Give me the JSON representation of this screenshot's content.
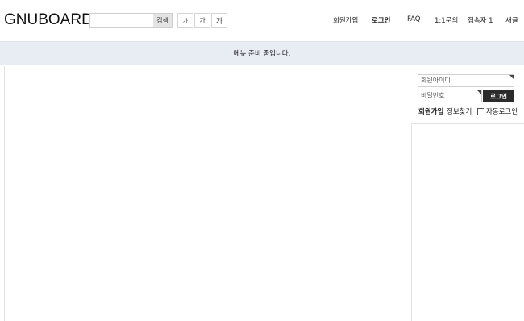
{
  "header": {
    "logo": "GNUBOARD5",
    "search": {
      "placeholder": "",
      "value": "",
      "button_label": "검색"
    },
    "font_size_buttons": [
      "가",
      "가",
      "가"
    ],
    "nav": [
      "회원가입",
      "로그인",
      "FAQ",
      "1:1문의",
      "접속자 1",
      "새글"
    ]
  },
  "notice": {
    "text": "메뉴 준비 중입니다."
  },
  "login": {
    "id_placeholder": "회원아이디",
    "pw_placeholder": "비밀번호",
    "button_label": "로그인",
    "register_label": "회원가입",
    "find_label": "정보찾기",
    "auto_login_label": "자동로그인",
    "auto_login_checked": false
  },
  "colors": {
    "notice_bg": "#e8ecf3",
    "login_button_bg": "#2b2b2b",
    "search_button_bg": "#e4e4e4"
  }
}
